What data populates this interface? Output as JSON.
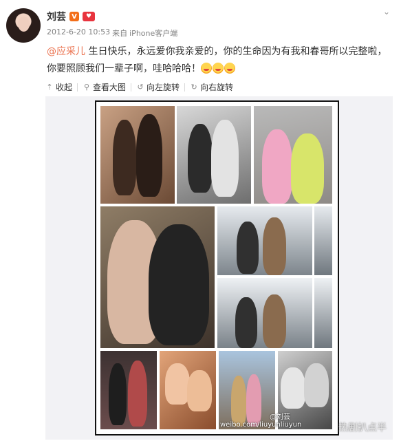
{
  "user": {
    "name": "刘芸",
    "verify_badge": "V",
    "member_badge": "♥"
  },
  "meta": {
    "time": "2012-6-20 10:53",
    "from": "来自",
    "source": "iPhone客户端"
  },
  "post": {
    "mention": "@应采儿",
    "text": " 生日快乐，永远爱你我亲爱的，你的生命因为有我和春哥所以完整啦，你要照顾我们一辈子啊，哇哈哈哈！"
  },
  "toolbar": {
    "collapse": "收起",
    "view_large": "查看大图",
    "rotate_left": "向左旋转",
    "rotate_right": "向右旋转"
  },
  "watermarks": {
    "weibo_user": "@刘芸",
    "weibo_url": "weibo.com/liuyunliuyun",
    "site": "热剧扒点半"
  },
  "colors": {
    "mention": "#eb7350",
    "verify": "#f36e19",
    "member": "#e8343e",
    "collage_border": "#111111"
  }
}
